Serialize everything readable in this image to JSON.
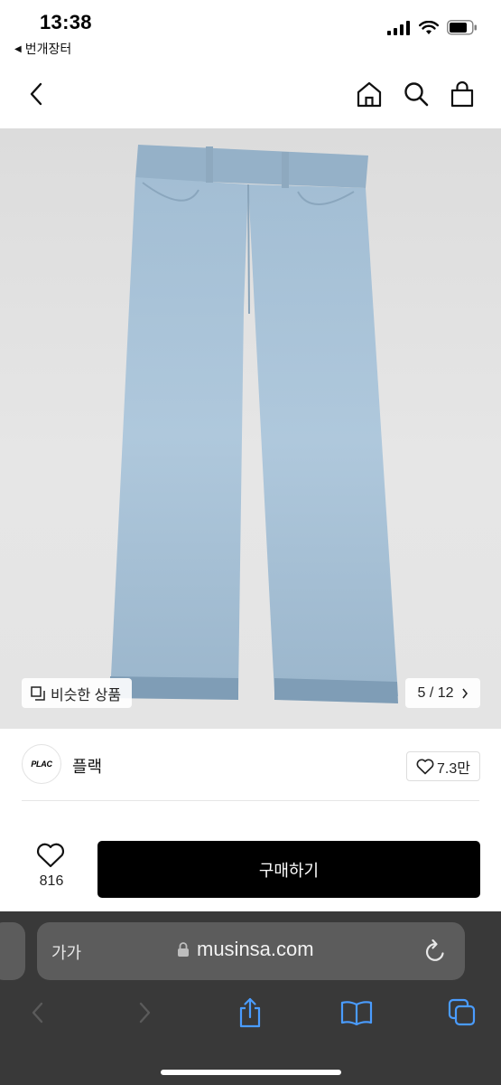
{
  "status": {
    "time": "13:38",
    "back_app": "번개장터"
  },
  "colors": {
    "page_bg": "#ffffff",
    "image_bg": "#e0e0e0",
    "buy_button": "#000000",
    "browser_bg": "#393939",
    "link_blue": "#4a9cff"
  },
  "nav": {
    "icons": [
      "chevron-left-icon",
      "home-icon",
      "search-icon",
      "shopping-bag-icon"
    ]
  },
  "product": {
    "similar_label": "비슷한 상품",
    "page_counter": "5 / 12",
    "brand_logo_text": "PLAC",
    "brand_name": "플랙",
    "like_count": "7.3만"
  },
  "purchase": {
    "wish_count": "816",
    "buy_label": "구매하기"
  },
  "browser": {
    "aa_label": "가가",
    "url": "musinsa.com"
  }
}
